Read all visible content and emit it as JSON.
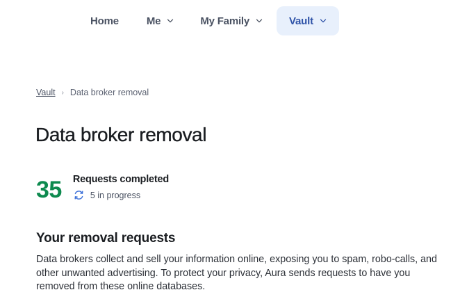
{
  "nav": {
    "items": [
      {
        "label": "Home",
        "has_dropdown": false,
        "active": false
      },
      {
        "label": "Me",
        "has_dropdown": true,
        "active": false
      },
      {
        "label": "My Family",
        "has_dropdown": true,
        "active": false
      },
      {
        "label": "Vault",
        "has_dropdown": true,
        "active": true
      }
    ]
  },
  "breadcrumb": {
    "parent": "Vault",
    "separator": "›",
    "current": "Data broker removal"
  },
  "page": {
    "title": "Data broker removal"
  },
  "stats": {
    "count": "35",
    "label": "Requests completed",
    "progress_text": "5 in progress",
    "progress_icon": "sync-icon"
  },
  "section": {
    "title": "Your removal requests",
    "description": "Data brokers collect and sell your information online, exposing you to spam, robo-calls, and other unwanted advertising. To protect your privacy, Aura sends requests to have you removed from these online databases."
  },
  "colors": {
    "accent_count": "#0e8a4f",
    "nav_active_bg": "#e8f0fc",
    "nav_active_text": "#2f53a8",
    "sync_icon": "#3b6fd8"
  }
}
